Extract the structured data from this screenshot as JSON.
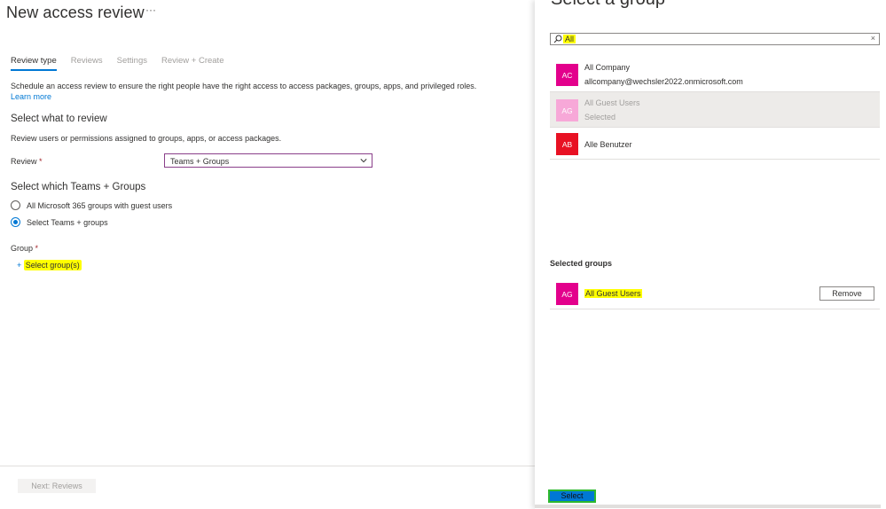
{
  "page": {
    "title": "New access review",
    "more": "···",
    "tabs": [
      "Review type",
      "Reviews",
      "Settings",
      "Review + Create"
    ],
    "description": "Schedule an access review to ensure the right people have the right access to access packages, groups, apps, and privileged roles.",
    "learn_more": "Learn more",
    "section_what": "Select what to review",
    "section_what_sub": "Review users or permissions assigned to groups, apps, or access packages.",
    "review_label": "Review",
    "required_mark": "*",
    "review_value": "Teams + Groups",
    "section_which": "Select which Teams + Groups",
    "radio_options": [
      "All Microsoft 365 groups with guest users",
      "Select Teams + groups"
    ],
    "radio_selected_index": 1,
    "group_label": "Group",
    "select_groups_plus": "+",
    "select_groups_link": "Select group(s)",
    "next_button": "Next: Reviews"
  },
  "panel": {
    "title": "Select a group",
    "search_value": "All",
    "search_clear": "×",
    "results": [
      {
        "initials": "AC",
        "name": "All Company",
        "sub": "allcompany@wechsler2022.onmicrosoft.com",
        "color": "#e3008c",
        "selected": false
      },
      {
        "initials": "AG",
        "name": "All Guest Users",
        "sub": "Selected",
        "color": "#f7a8d8",
        "selected": true
      },
      {
        "initials": "AB",
        "name": "Alle Benutzer",
        "sub": "",
        "color": "#e81123",
        "selected": false
      }
    ],
    "selected_heading": "Selected groups",
    "selected_items": [
      {
        "initials": "AG",
        "name": "All Guest Users",
        "color": "#e3008c",
        "remove_label": "Remove"
      }
    ],
    "select_button": "Select"
  },
  "colors": {
    "accent": "#0078d4",
    "highlight": "#ffff00"
  }
}
